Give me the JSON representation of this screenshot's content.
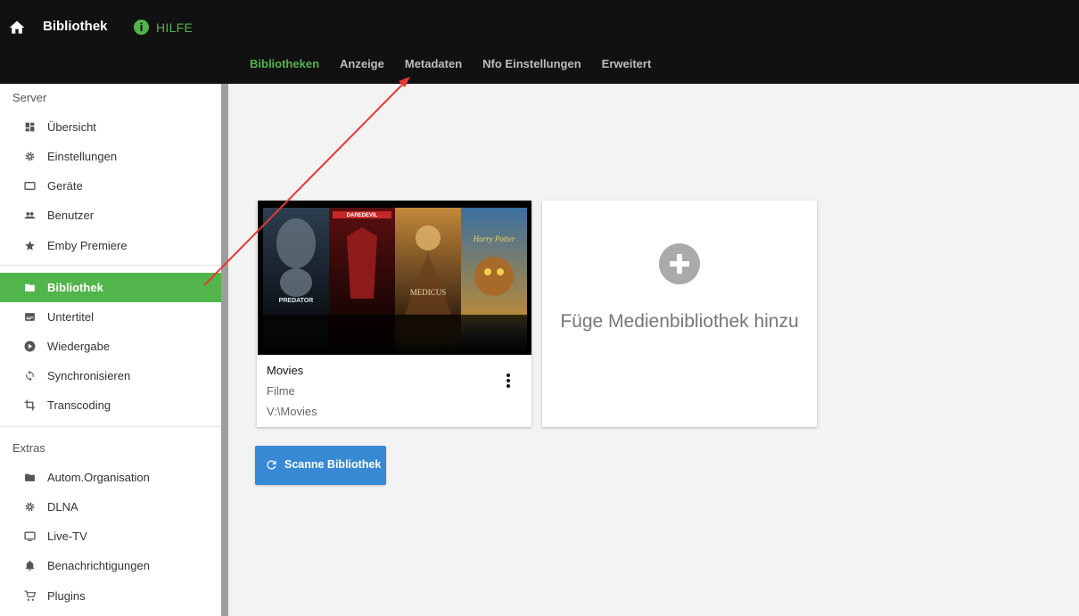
{
  "header": {
    "title": "Bibliothek",
    "help_label": "HILFE",
    "help_icon": "info-icon",
    "tabs": [
      {
        "label": "Bibliotheken",
        "active": true
      },
      {
        "label": "Anzeige",
        "active": false
      },
      {
        "label": "Metadaten",
        "active": false
      },
      {
        "label": "Nfo Einstellungen",
        "active": false
      },
      {
        "label": "Erweitert",
        "active": false
      }
    ]
  },
  "sidebar": {
    "server_header": "Server",
    "server_items": [
      {
        "label": "Übersicht",
        "icon": "dashboard-icon"
      },
      {
        "label": "Einstellungen",
        "icon": "gear-icon"
      },
      {
        "label": "Geräte",
        "icon": "device-icon"
      },
      {
        "label": "Benutzer",
        "icon": "people-icon"
      },
      {
        "label": "Emby Premiere",
        "icon": "star-icon"
      }
    ],
    "library_items": [
      {
        "label": "Bibliothek",
        "icon": "folder-icon",
        "active": true
      },
      {
        "label": "Untertitel",
        "icon": "subtitles-icon"
      },
      {
        "label": "Wiedergabe",
        "icon": "play-icon"
      },
      {
        "label": "Synchronisieren",
        "icon": "sync-icon"
      },
      {
        "label": "Transcoding",
        "icon": "crop-icon"
      }
    ],
    "extras_header": "Extras",
    "extras_items": [
      {
        "label": "Autom.Organisation",
        "icon": "folder-icon"
      },
      {
        "label": "DLNA",
        "icon": "gear-icon"
      },
      {
        "label": "Live-TV",
        "icon": "tv-icon"
      },
      {
        "label": "Benachrichtigungen",
        "icon": "bell-icon"
      },
      {
        "label": "Plugins",
        "icon": "cart-icon"
      }
    ]
  },
  "main": {
    "library_card": {
      "title": "Movies",
      "type": "Filme",
      "path": "V:\\Movies",
      "poster_texts": [
        "PREDATOR",
        "DAREDEVIL",
        "MEDICUS",
        "Harry Potter"
      ]
    },
    "add_card": {
      "label": "Füge Medienbibliothek hinzu"
    },
    "scan_button": {
      "label": "Scanne Bibliothek"
    }
  },
  "colors": {
    "accent": "#52b54b",
    "header_bg": "#111111",
    "button_blue": "#3889d4",
    "arrow_red": "#e53935"
  }
}
